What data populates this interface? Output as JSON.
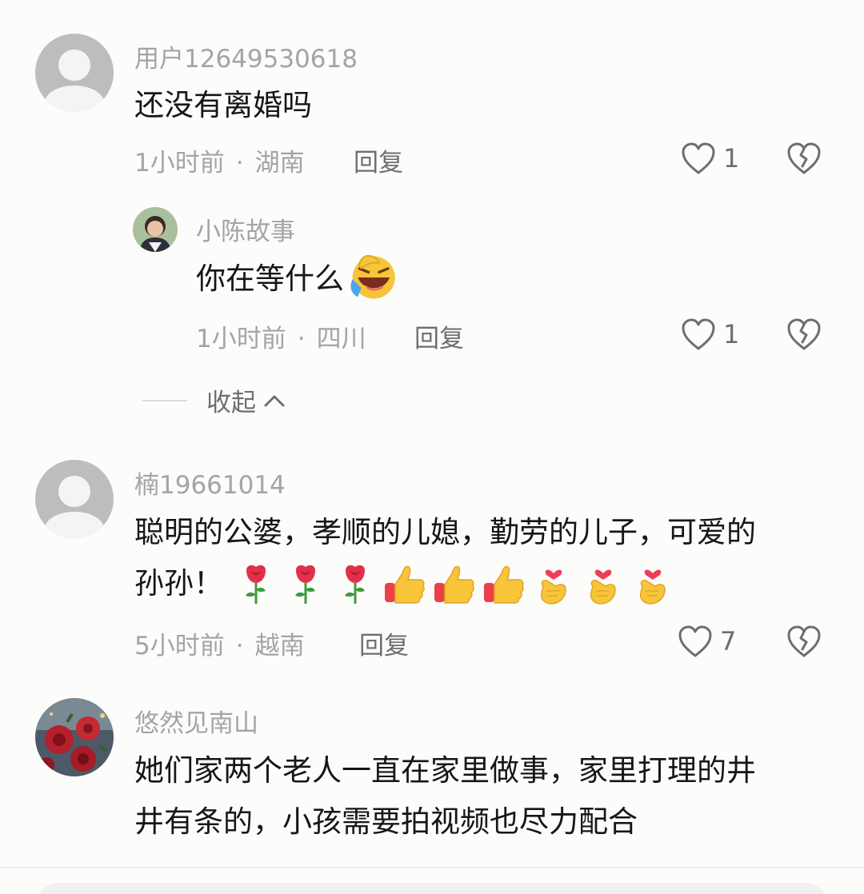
{
  "comments": [
    {
      "username": "用户12649530618",
      "content": "还没有离婚吗",
      "time": "1小时前",
      "location": "湖南",
      "reply_label": "回复",
      "likes": "1",
      "replies": [
        {
          "username": "小陈故事",
          "content": "你在等什么",
          "emoji": "laughing-tears-emoji",
          "time": "1小时前",
          "location": "四川",
          "reply_label": "回复",
          "likes": "1"
        }
      ],
      "collapse_label": "收起"
    },
    {
      "username": "楠19661014",
      "content": "聪明的公婆，孝顺的儿媳，勤劳的儿子，可爱的",
      "content_line2": "孙孙！",
      "emojis": [
        "rose-emoji",
        "rose-emoji",
        "rose-emoji",
        "thumbs-up-emoji",
        "thumbs-up-emoji",
        "thumbs-up-emoji",
        "finger-heart-emoji",
        "finger-heart-emoji",
        "finger-heart-emoji"
      ],
      "time": "5小时前",
      "location": "越南",
      "reply_label": "回复",
      "likes": "7"
    },
    {
      "username": "悠然见南山",
      "content": "她们家两个老人一直在家里做事，家里打理的井",
      "content_line2": "井有条的，小孩需要拍视频也尽力配合"
    }
  ],
  "colors": {
    "background": "#fcfcfb",
    "text_primary": "#161616",
    "text_secondary": "#a4a4a4",
    "text_action": "#6e6e6e"
  }
}
